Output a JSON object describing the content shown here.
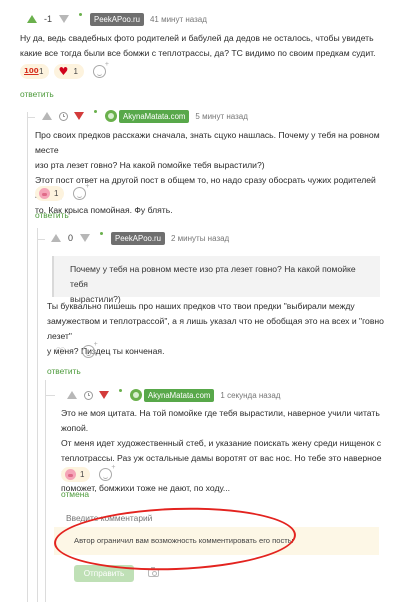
{
  "comment1": {
    "score": "-1",
    "author": "PeekAPoo.ru",
    "time": "41 минут назад",
    "text": "Ну да, ведь свадебных фото родителей и бабулей да дедов не осталось, чтобы увидеть какие все тогда были все бомжи с теплотрассы, да? ТС видимо по своим предкам судит.",
    "reactions": [
      {
        "emoji": "emoji-100-icon",
        "count": "1"
      },
      {
        "emoji": "heart-icon",
        "count": "1"
      }
    ],
    "reply_label": "ответить"
  },
  "comment2": {
    "author": "AkynaMatata.com",
    "time": "5 минут назад",
    "text_lines": [
      "Про своих предков расскажи сначала, знать сцуко нашлась. Почему у тебя на ровном месте",
      "изо рта лезет говно? На какой помойке тебя вырастили?)",
      "Этот пост ответ на другой пост в общем то, но надо сразу обосрать чужих родителей почему",
      "то. Как крыса помойная. Фу блять."
    ],
    "reactions": [
      {
        "emoji": "pig-icon",
        "count": "1"
      }
    ],
    "reply_label": "ответить"
  },
  "comment3": {
    "score": "0",
    "author": "PeekAPoo.ru",
    "time": "2 минуты назад",
    "quote_lines": [
      "Почему у тебя на ровном месте изо рта лезет говно? На какой помойке тебя",
      "вырастили?)"
    ],
    "text_lines": [
      "Ты буквально пишешь про наших предков что твои предки \"выбирали между",
      "замужеством и теплотрассой\", а я лишь указал что не обобщая это на всех и \"говно лезет\"",
      "у меня? Пиздец ты конченая."
    ],
    "reply_label": "ответить"
  },
  "comment4": {
    "author": "AkynaMatata.com",
    "time": "1 секунда назад",
    "text_lines": [
      "Это не моя цитата. На той помойке где тебя вырастили, наверное учили читать жопой.",
      "От меня идет художественный стеб, и указание поискать жену среди нищенок с",
      "теплотрассы. Раз уж остальные дамы воротят от вас нос. Но тебе это наверное не",
      "поможет, бомжихи тоже не дают, по ходу..."
    ],
    "reactions": [
      {
        "emoji": "pig-icon",
        "count": "1"
      }
    ],
    "cancel_label": "отмена"
  },
  "reply_form": {
    "placeholder": "Введите комментарий",
    "restriction": "Автор ограничил вам возможность комментировать его посты",
    "send_label": "Отправить"
  },
  "colors": {
    "accent_green": "#58a84a",
    "annotation_red": "#e3231f"
  }
}
